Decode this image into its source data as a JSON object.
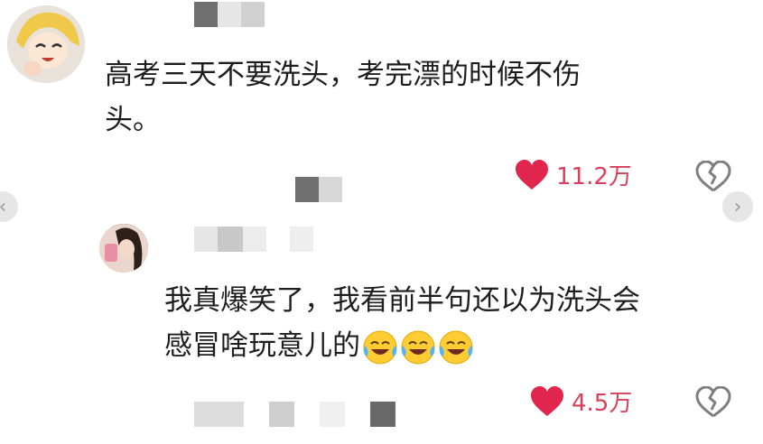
{
  "comments": [
    {
      "text_line1": "高考三天不要洗头，考完漂的时候不伤",
      "text_line2": "头。",
      "likes": "11.2万",
      "like_icon": "heart-icon",
      "dislike_icon": "broken-heart-icon"
    },
    {
      "text_line1": "我真爆笑了，我看前半句还以为洗头会",
      "text_line2": "感冒啥玩意儿的",
      "emojis": [
        "laughing-crying-emoji",
        "laughing-crying-emoji",
        "laughing-crying-emoji"
      ],
      "likes": "4.5万",
      "like_icon": "heart-icon",
      "dislike_icon": "broken-heart-icon"
    }
  ],
  "colors": {
    "like": "#d93f5b",
    "text": "#1e1e1e",
    "icon_gray": "#8a8a8a",
    "mosaic_dark": "#6f6f6f",
    "mosaic_light": "#d6d6d6"
  }
}
